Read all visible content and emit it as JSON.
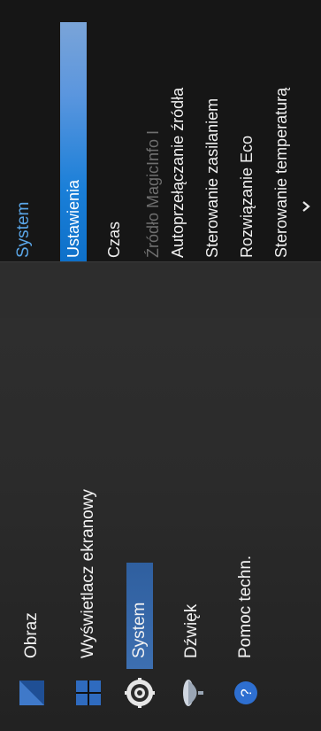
{
  "main_menu": {
    "items": [
      {
        "label": "Obraz",
        "icon": "picture-icon"
      },
      {
        "label": "Wyświetlacz ekranowy",
        "icon": "onscreen-display-icon"
      },
      {
        "label": "System",
        "icon": "gear-icon"
      },
      {
        "label": "Dźwięk",
        "icon": "speaker-icon"
      },
      {
        "label": "Pomoc techn.",
        "icon": "help-icon"
      }
    ],
    "selected": "System"
  },
  "sub_menu": {
    "title": "System",
    "items": [
      {
        "label": "Ustawienia",
        "state": "highlighted"
      },
      {
        "label": "Czas",
        "state": "normal"
      },
      {
        "label": "Źródło MagicInfo I",
        "state": "disabled"
      },
      {
        "label": "Autoprzełączanie źródła",
        "state": "normal"
      },
      {
        "label": "Sterowanie zasilaniem",
        "state": "normal"
      },
      {
        "label": "Rozwiązanie Eco",
        "state": "normal"
      },
      {
        "label": "Sterowanie temperaturą",
        "state": "normal"
      }
    ],
    "more_icon": "chevron-down-icon"
  },
  "colors": {
    "accent": "#1a7fd8",
    "title_blue": "#5aa6e8",
    "selected_bg": "#2f5f9f",
    "panel_bg": "#161616"
  }
}
